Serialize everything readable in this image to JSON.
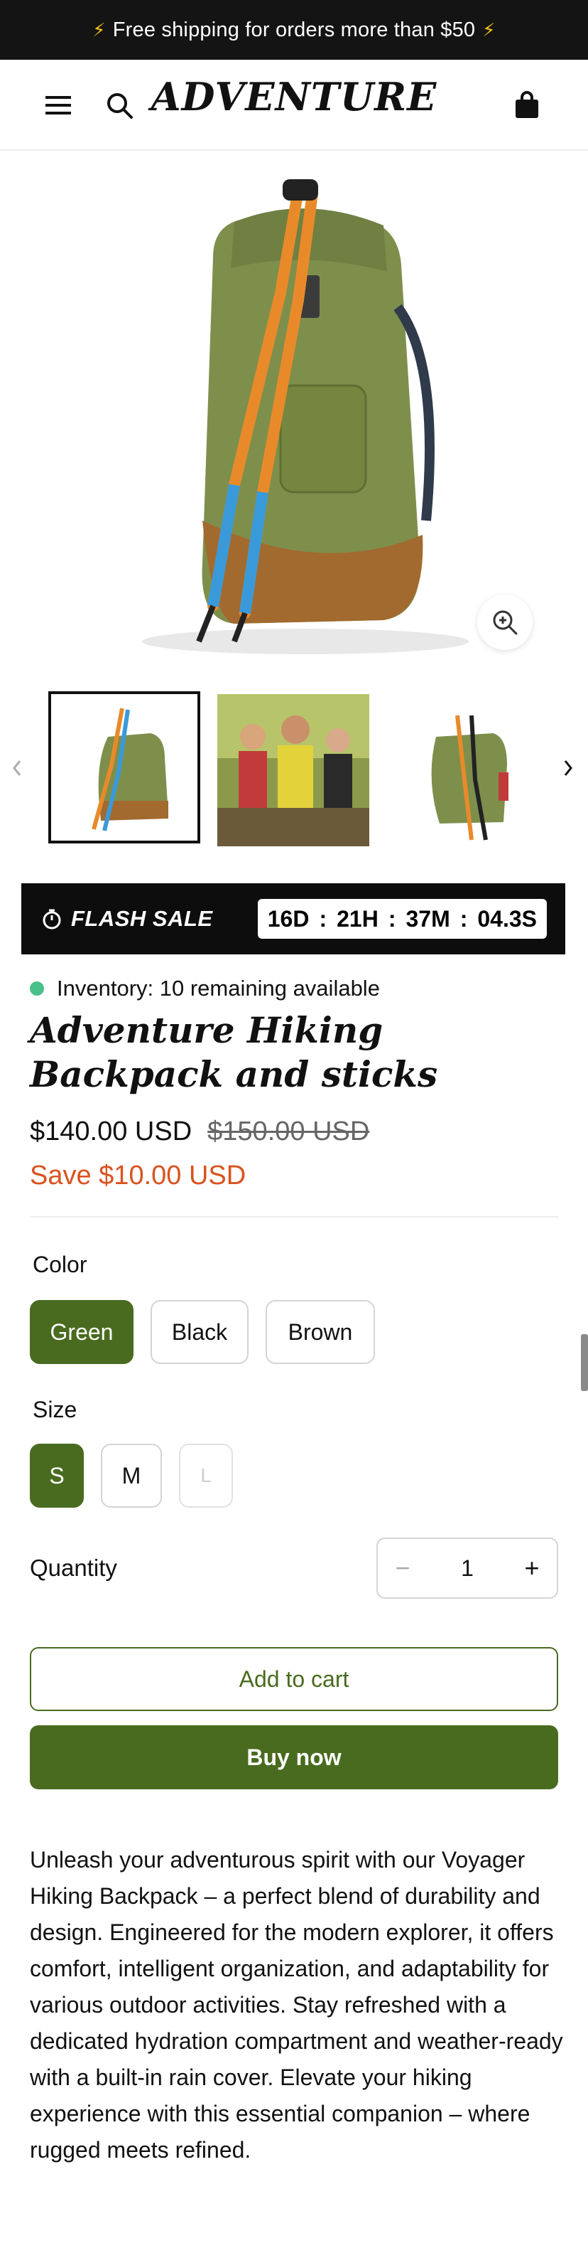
{
  "announcement": {
    "text": "Free shipping for orders more than $50",
    "icon": "lightning-bolt-icon",
    "icon_color": "#f5c518"
  },
  "header": {
    "logo": "ADVENTURE",
    "icons": [
      "menu-icon",
      "search-icon",
      "shopping-bag-icon"
    ]
  },
  "gallery": {
    "hero_alt": "Green hiking backpack with trekking poles",
    "zoom_icon": "zoom-in-icon",
    "thumbnails": [
      {
        "alt": "Backpack with poles",
        "active": true
      },
      {
        "alt": "Group of hikers",
        "active": false
      },
      {
        "alt": "Backpack side view",
        "active": false
      }
    ]
  },
  "flash_sale": {
    "label": "FLASH SALE",
    "days": "16D",
    "hours": "21H",
    "minutes": "37M",
    "seconds": "04.3S",
    "separator": ":"
  },
  "product": {
    "inventory": "Inventory: 10 remaining available",
    "inventory_color": "#4bbf8a",
    "title": "Adventure Hiking Backpack and sticks",
    "price": "$140.00 USD",
    "compare_price": "$150.00 USD",
    "savings": "Save $10.00 USD"
  },
  "options": {
    "color": {
      "label": "Color",
      "values": [
        "Green",
        "Black",
        "Brown"
      ],
      "selected": "Green"
    },
    "size": {
      "label": "Size",
      "values": [
        "S",
        "M",
        "L"
      ],
      "selected": "S"
    }
  },
  "quantity": {
    "label": "Quantity",
    "value": "1",
    "minus": "−",
    "plus": "+"
  },
  "actions": {
    "add_to_cart": "Add to cart",
    "buy_now": "Buy now"
  },
  "description": "Unleash your adventurous spirit with our Voyager Hiking Backpack – a perfect blend of durability and design. Engineered for the modern explorer, it offers comfort, intelligent organization, and adaptability for various outdoor activities. Stay refreshed with a dedicated hydration compartment and weather-ready with a built-in rain cover. Elevate your hiking experience with this essential companion – where rugged meets refined.",
  "colors": {
    "brand_green": "#496b1f",
    "sale_orange": "#d9531e",
    "dark": "#141414"
  }
}
